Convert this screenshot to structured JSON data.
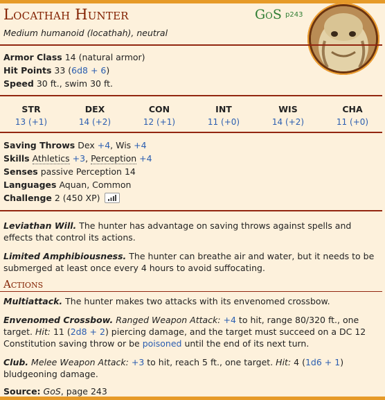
{
  "creature": {
    "name": "Locathah Hunter",
    "source_abbr": "GoS",
    "source_page": "p243",
    "type_line": "Medium humanoid (locathah), neutral"
  },
  "stats": {
    "ac_label": "Armor Class",
    "ac_value": "14 (natural armor)",
    "hp_label": "Hit Points",
    "hp_value": "33 (",
    "hp_dice": "6d8 + 6",
    "hp_close": ")",
    "speed_label": "Speed",
    "speed_value": "30 ft., swim 30 ft."
  },
  "abilities": [
    {
      "name": "STR",
      "value": "13 (+1)"
    },
    {
      "name": "DEX",
      "value": "14 (+2)"
    },
    {
      "name": "CON",
      "value": "12 (+1)"
    },
    {
      "name": "INT",
      "value": "11 (+0)"
    },
    {
      "name": "WIS",
      "value": "14 (+2)"
    },
    {
      "name": "CHA",
      "value": "11 (+0)"
    }
  ],
  "details": {
    "saves_label": "Saving Throws",
    "saves_dex": "Dex",
    "saves_dex_mod": "+4",
    "saves_wis": ", Wis",
    "saves_wis_mod": "+4",
    "skills_label": "Skills",
    "skill_athletics": "Athletics",
    "skill_athletics_mod": "+3",
    "skill_sep": ",",
    "skill_perception": "Perception",
    "skill_perception_mod": "+4",
    "senses_label": "Senses",
    "senses_value": "passive Perception 14",
    "languages_label": "Languages",
    "languages_value": "Aquan, Common",
    "challenge_label": "Challenge",
    "challenge_value": "2 (450 XP)"
  },
  "traits": [
    {
      "name": "Leviathan Will.",
      "text": "The hunter has advantage on saving throws against spells and effects that control its actions."
    },
    {
      "name": "Limited Amphibiousness.",
      "text": "The hunter can breathe air and water, but it needs to be submerged at least once every 4 hours to avoid suffocating."
    }
  ],
  "actions_header": "Actions",
  "actions": {
    "multi_name": "Multiattack.",
    "multi_text": "The hunter makes two attacks with its envenomed crossbow.",
    "cross_name": "Envenomed Crossbow.",
    "cross_type": "Ranged Weapon Attack:",
    "cross_hit": "+4",
    "cross_t1": "to hit, range 80/320 ft., one target.",
    "cross_hit_label": "Hit:",
    "cross_dmg": "11 (",
    "cross_dice": "2d8 + 2",
    "cross_t2": ") piercing damage, and the target must succeed on a DC 12 Constitution saving throw or be",
    "cross_cond": "poisoned",
    "cross_t3": "until the end of its next turn.",
    "club_name": "Club.",
    "club_type": "Melee Weapon Attack:",
    "club_hit": "+3",
    "club_t1": "to hit, reach 5 ft., one target.",
    "club_hit_label": "Hit:",
    "club_dmg": "4 (",
    "club_dice": "1d6 + 1",
    "club_t2": ") bludgeoning damage."
  },
  "source": {
    "label": "Source:",
    "book": "GoS",
    "page": ", page 243"
  },
  "colors": {
    "accent": "#822000",
    "rule": "#922610",
    "link": "#2a5db0",
    "source_green": "#2e7d32",
    "edge": "#e69a28"
  }
}
